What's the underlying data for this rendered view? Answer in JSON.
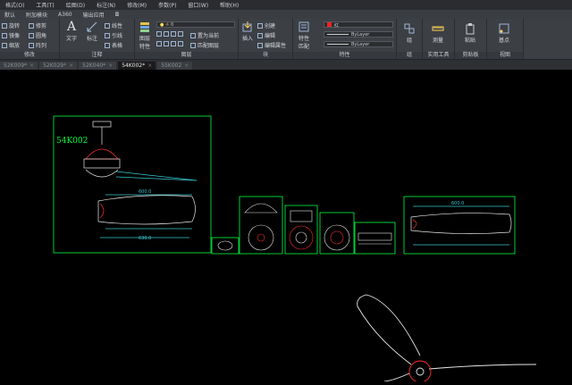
{
  "menubar": [
    "格式(O)",
    "工具(T)",
    "绘图(D)",
    "标注(N)",
    "修改(M)",
    "参数(P)",
    "窗口(W)",
    "帮助(H)"
  ],
  "ribbon_tabs": [
    "默认",
    "附加模块",
    "A360",
    "输出应用",
    "◘"
  ],
  "panels": {
    "modify": {
      "label": "修改",
      "tools": [
        "旋转",
        "修剪",
        "镜像",
        "圆角",
        "缩放",
        "阵列"
      ]
    },
    "annotation": {
      "label": "注释",
      "text": "文字",
      "dimension": "标注",
      "tools": [
        "线性",
        "引线",
        "表格"
      ]
    },
    "layers": {
      "label": "图层",
      "layer_props": "图层\n特性",
      "current_layer": "0",
      "tools": [
        "置为当前",
        "匹配图层"
      ]
    },
    "block": {
      "label": "块",
      "insert": "插入",
      "tools": [
        "创建",
        "编辑",
        "编辑属性"
      ]
    },
    "properties": {
      "label": "特性",
      "match": "特性\n匹配",
      "color": "红",
      "linetype": "ByLayer",
      "lineweight": "ByLayer"
    },
    "groups": {
      "label": "组",
      "tool": "组"
    },
    "utilities": {
      "label": "实用工具",
      "tool": "测量"
    },
    "clipboard": {
      "label": "剪贴板",
      "tool": "粘贴"
    },
    "view": {
      "label": "视图",
      "tool": "基点"
    }
  },
  "doc_tabs": [
    {
      "name": "52K009*",
      "active": false
    },
    {
      "name": "52K029*",
      "active": false
    },
    {
      "name": "52K040*",
      "active": false
    },
    {
      "name": "54K002*",
      "active": true
    },
    {
      "name": "55K002",
      "active": false
    }
  ],
  "drawing": {
    "label_main": "54K002",
    "dims": [
      "600.0",
      "630.0",
      "600.0"
    ]
  },
  "colors": {
    "accent_red": "#ff2020",
    "line_green": "#00ff40",
    "line_cyan": "#38c8d0",
    "line_white": "#e8e8e8"
  }
}
